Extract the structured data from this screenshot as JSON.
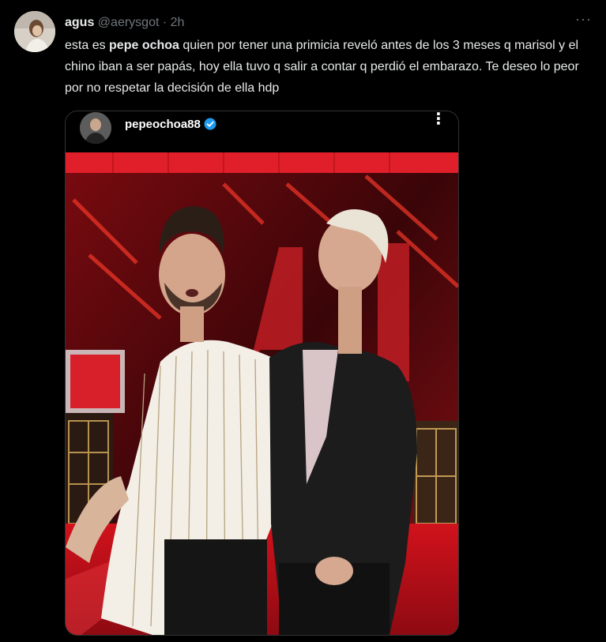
{
  "tweet": {
    "author_name": "agus",
    "author_handle": "@aerysgot",
    "separator": "·",
    "time": "2h",
    "more_glyph": "···",
    "text_before": "esta es ",
    "text_bold": "pepe ochoa",
    "text_after": " quien por tener una primicia reveló antes de los 3 meses q marisol y el chino iban a ser papás, hoy ella tuvo q salir a contar q perdió el embarazo. Te deseo lo peor por no respetar la decisión de ella hdp"
  },
  "embed": {
    "username": "pepeochoa88",
    "verified": true,
    "more_glyph": "⋮",
    "photo_icon": "photo-icon",
    "colors": {
      "accent_blue": "#1d9bf0",
      "studio_red": "#c0101a"
    }
  }
}
